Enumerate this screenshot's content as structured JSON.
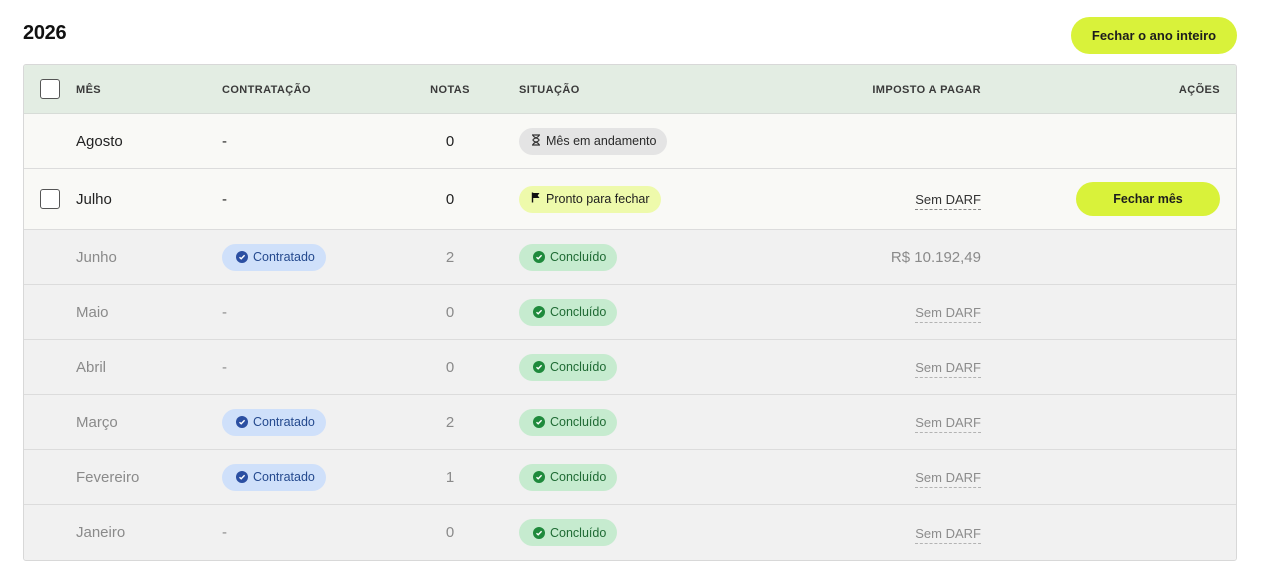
{
  "header": {
    "year": "2026",
    "close_year_label": "Fechar o ano inteiro"
  },
  "table": {
    "columns": {
      "month": "MÊS",
      "hiring": "CONTRATAÇÃO",
      "notes": "NOTAS",
      "status": "SITUAÇÃO",
      "tax": "IMPOSTO A PAGAR",
      "actions": "AÇÕES"
    },
    "rows": [
      {
        "month": "Agosto",
        "hiring": "-",
        "notes": "0",
        "status": "Mês em andamento",
        "status_icon": "hourglass-icon",
        "tax": "",
        "action": ""
      },
      {
        "month": "Julho",
        "hiring": "-",
        "notes": "0",
        "status": "Pronto para fechar",
        "status_icon": "flag-icon",
        "tax": "Sem DARF",
        "action": "Fechar mês"
      },
      {
        "month": "Junho",
        "hiring": "Contratado",
        "notes": "2",
        "status": "Concluído",
        "status_icon": "check-circle-icon",
        "tax": "R$ 10.192,49",
        "action": ""
      },
      {
        "month": "Maio",
        "hiring": "-",
        "notes": "0",
        "status": "Concluído",
        "status_icon": "check-circle-icon",
        "tax": "Sem DARF",
        "action": ""
      },
      {
        "month": "Abril",
        "hiring": "-",
        "notes": "0",
        "status": "Concluído",
        "status_icon": "check-circle-icon",
        "tax": "Sem DARF",
        "action": ""
      },
      {
        "month": "Março",
        "hiring": "Contratado",
        "notes": "2",
        "status": "Concluído",
        "status_icon": "check-circle-icon",
        "tax": "Sem DARF",
        "action": ""
      },
      {
        "month": "Fevereiro",
        "hiring": "Contratado",
        "notes": "1",
        "status": "Concluído",
        "status_icon": "check-circle-icon",
        "tax": "Sem DARF",
        "action": ""
      },
      {
        "month": "Janeiro",
        "hiring": "-",
        "notes": "0",
        "status": "Concluído",
        "status_icon": "check-circle-icon",
        "tax": "Sem DARF",
        "action": ""
      }
    ]
  },
  "colors": {
    "accent": "#d9f23a",
    "header_bg": "#e3ede3",
    "done_badge": "#c6ebcf",
    "hired_badge": "#cfe0fa",
    "ready_badge": "#eefaab",
    "progress_badge": "#e4e4e4"
  }
}
